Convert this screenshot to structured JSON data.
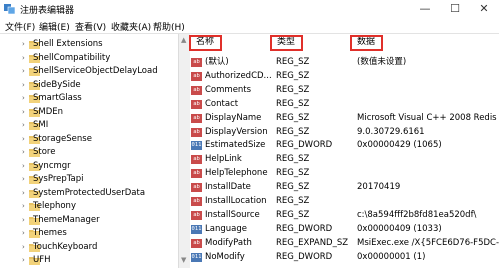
{
  "window": {
    "title": "注册表编辑器",
    "buttons": {
      "minimize": "—",
      "maximize": "☐",
      "close": "✕"
    }
  },
  "menu": [
    "文件(F)",
    "编辑(E)",
    "查看(V)",
    "收藏夹(A)",
    "帮助(H)"
  ],
  "tree": {
    "items": [
      "Shell Extensions",
      "ShellCompatibility",
      "ShellServiceObjectDelayLoad",
      "SideBySide",
      "SmartGlass",
      "SMDEn",
      "SMI",
      "StorageSense",
      "Store",
      "Syncmgr",
      "SysPrepTapi",
      "SystemProtectedUserData",
      "Telephony",
      "ThemeManager",
      "Themes",
      "TouchKeyboard",
      "UFH"
    ]
  },
  "list": {
    "headers": {
      "name": "名称",
      "type": "类型",
      "data": "数据"
    },
    "rows": [
      {
        "icon": "ab",
        "name": "(默认)",
        "type": "REG_SZ",
        "data": "(数值未设置)"
      },
      {
        "icon": "ab",
        "name": "AuthorizedCD...",
        "type": "REG_SZ",
        "data": ""
      },
      {
        "icon": "ab",
        "name": "Comments",
        "type": "REG_SZ",
        "data": ""
      },
      {
        "icon": "ab",
        "name": "Contact",
        "type": "REG_SZ",
        "data": ""
      },
      {
        "icon": "ab",
        "name": "DisplayName",
        "type": "REG_SZ",
        "data": "Microsoft Visual C++ 2008 Redis"
      },
      {
        "icon": "ab",
        "name": "DisplayVersion",
        "type": "REG_SZ",
        "data": "9.0.30729.6161"
      },
      {
        "icon": "bin",
        "name": "EstimatedSize",
        "type": "REG_DWORD",
        "data": "0x00000429 (1065)"
      },
      {
        "icon": "ab",
        "name": "HelpLink",
        "type": "REG_SZ",
        "data": ""
      },
      {
        "icon": "ab",
        "name": "HelpTelephone",
        "type": "REG_SZ",
        "data": ""
      },
      {
        "icon": "ab",
        "name": "InstallDate",
        "type": "REG_SZ",
        "data": "20170419"
      },
      {
        "icon": "ab",
        "name": "InstallLocation",
        "type": "REG_SZ",
        "data": ""
      },
      {
        "icon": "ab",
        "name": "InstallSource",
        "type": "REG_SZ",
        "data": "c:\\8a594fff2b8fd81ea520df\\"
      },
      {
        "icon": "bin",
        "name": "Language",
        "type": "REG_DWORD",
        "data": "0x00000409 (1033)"
      },
      {
        "icon": "ab",
        "name": "ModifyPath",
        "type": "REG_EXPAND_SZ",
        "data": "MsiExec.exe /X{5FCE6D76-F5DC-"
      },
      {
        "icon": "bin",
        "name": "NoModify",
        "type": "REG_DWORD",
        "data": "0x00000001 (1)"
      }
    ]
  },
  "colors": {
    "highlight_box": "#e0302a",
    "folder": "#e8c262",
    "string_icon": "#c94b4b",
    "binary_icon": "#4a78b5"
  }
}
